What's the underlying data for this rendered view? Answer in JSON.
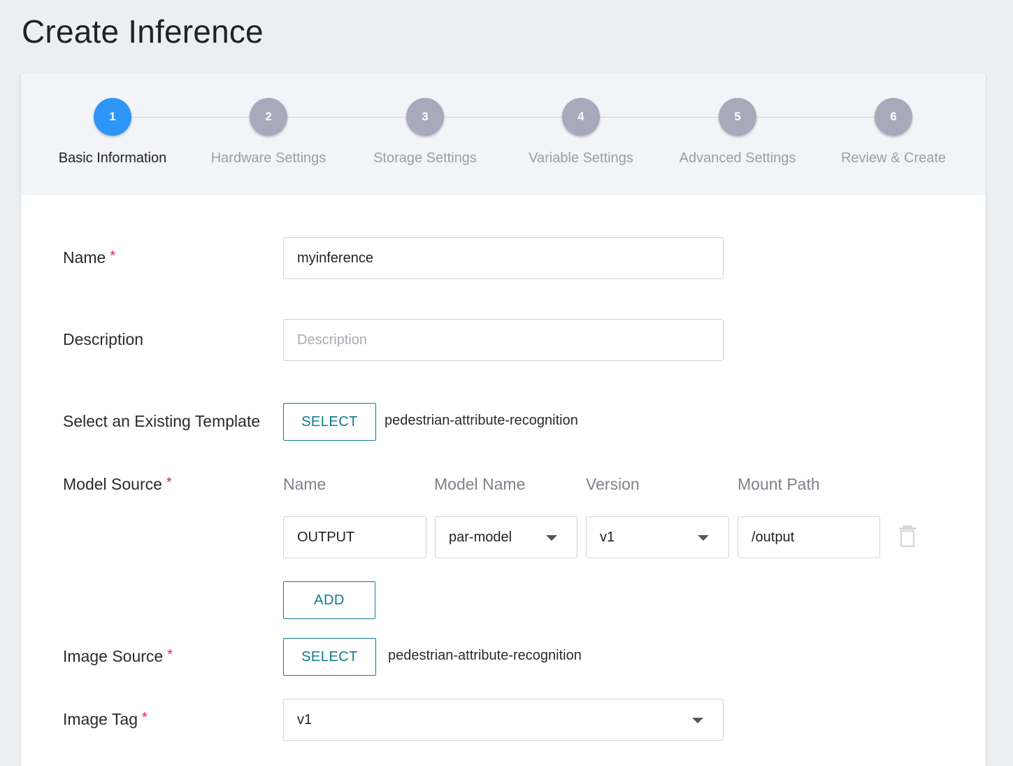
{
  "page": {
    "title": "Create Inference"
  },
  "stepper": {
    "steps": [
      {
        "number": "1",
        "label": "Basic Information",
        "active": true
      },
      {
        "number": "2",
        "label": "Hardware Settings",
        "active": false
      },
      {
        "number": "3",
        "label": "Storage Settings",
        "active": false
      },
      {
        "number": "4",
        "label": "Variable Settings",
        "active": false
      },
      {
        "number": "5",
        "label": "Advanced Settings",
        "active": false
      },
      {
        "number": "6",
        "label": "Review & Create",
        "active": false
      }
    ]
  },
  "form": {
    "name": {
      "label": "Name",
      "required_mark": "*",
      "value": "myinference"
    },
    "description": {
      "label": "Description",
      "placeholder": "Description",
      "value": ""
    },
    "template": {
      "label": "Select an Existing Template",
      "button": "SELECT",
      "value": "pedestrian-attribute-recognition"
    },
    "model_source": {
      "label": "Model Source",
      "required_mark": "*",
      "columns": {
        "name": "Name",
        "model_name": "Model Name",
        "version": "Version",
        "mount_path": "Mount Path"
      },
      "row": {
        "name": "OUTPUT",
        "model_name": "par-model",
        "version": "v1",
        "mount_path": "/output"
      },
      "add_button": "ADD"
    },
    "image_source": {
      "label": "Image Source",
      "required_mark": "*",
      "button": "SELECT",
      "value": "pedestrian-attribute-recognition"
    },
    "image_tag": {
      "label": "Image Tag",
      "required_mark": "*",
      "value": "v1"
    }
  },
  "icons": {
    "delete_row": "trash-icon",
    "dropdown": "caret-down-icon"
  },
  "colors": {
    "active_step": "#2d96f6",
    "inactive_step": "#a6aabb",
    "accent": "#0f7b8e",
    "required": "#e0204c"
  }
}
